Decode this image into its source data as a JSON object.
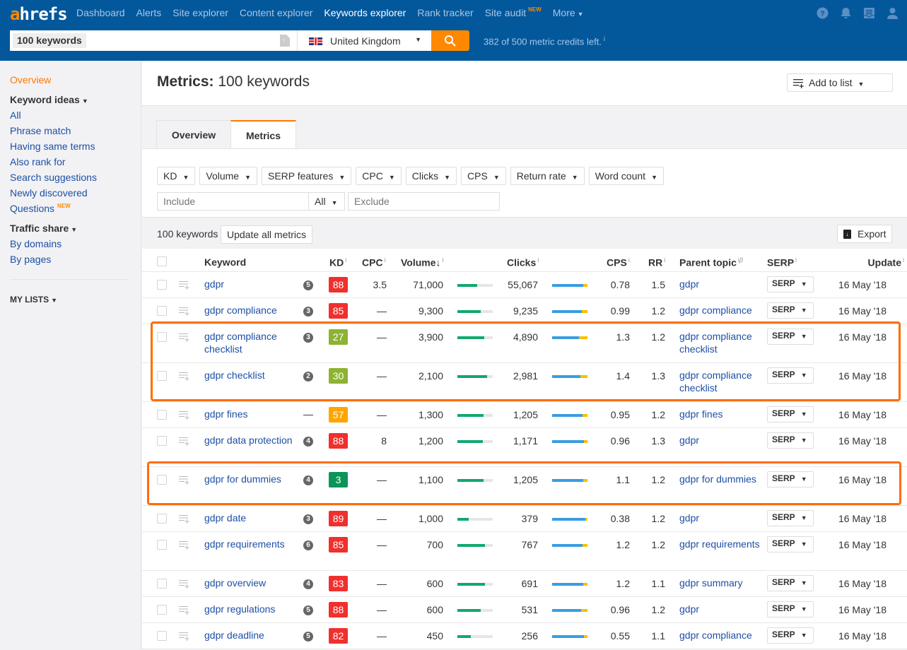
{
  "brand": {
    "logo_a": "a",
    "logo_rest": "hrefs",
    "accent": "#ff8800",
    "header_bg": "#03589c"
  },
  "nav": [
    {
      "label": "Dashboard",
      "active": false
    },
    {
      "label": "Alerts",
      "active": false
    },
    {
      "label": "Site explorer",
      "active": false
    },
    {
      "label": "Content explorer",
      "active": false
    },
    {
      "label": "Keywords explorer",
      "active": true
    },
    {
      "label": "Rank tracker",
      "active": false
    },
    {
      "label": "Site audit",
      "badge": "NEW",
      "active": false
    },
    {
      "label": "More",
      "active": false
    }
  ],
  "top_icons": [
    "help-icon",
    "bell-icon",
    "messages-icon",
    "user-icon"
  ],
  "search": {
    "keyword_chip": "100 keywords",
    "country": "United Kingdom",
    "credits": "382 of 500 metric credits left.",
    "credits_info": "i"
  },
  "sidebar": {
    "overview": "Overview",
    "keyword_ideas": "Keyword ideas",
    "idea_items": [
      "All",
      "Phrase match",
      "Having same terms",
      "Also rank for",
      "Search suggestions",
      "Newly discovered",
      "Questions"
    ],
    "questions_badge": "NEW",
    "traffic_share": "Traffic share",
    "traffic_items": [
      "By domains",
      "By pages"
    ],
    "my_lists": "MY LISTS"
  },
  "page": {
    "title_bold": "Metrics:",
    "title_rest": "100 keywords",
    "add_to_list": "Add to list"
  },
  "tabs": [
    {
      "label": "Overview",
      "active": false
    },
    {
      "label": "Metrics",
      "active": true
    }
  ],
  "filters": {
    "buttons": [
      "KD",
      "Volume",
      "SERP features",
      "CPC",
      "Clicks",
      "CPS",
      "Return rate",
      "Word count"
    ],
    "include_placeholder": "Include",
    "match_mode": "All",
    "exclude_placeholder": "Exclude"
  },
  "count_bar": {
    "count": "100 keywords",
    "update_all": "Update all metrics",
    "export": "Export"
  },
  "table": {
    "headers": {
      "keyword": "Keyword",
      "kd": "KD",
      "cpc": "CPC",
      "volume": "Volume",
      "clicks": "Clicks",
      "cps": "CPS",
      "rr": "RR",
      "parent_topic": "Parent topic",
      "serp": "SERP",
      "update": "Update",
      "info": "i",
      "beta": "β",
      "sort_arrow": "↓"
    },
    "serp_button": "SERP",
    "rows": [
      {
        "keyword": "gdpr",
        "serp_features": "5",
        "kd": "88",
        "kd_color": "#f0302d",
        "cpc": "3.5",
        "volume": "71,000",
        "volume_bar": 0.56,
        "clicks": "55,067",
        "clicks_organic_share": 0.88,
        "cps": "0.78",
        "rr": "1.5",
        "parent_topic": "gdpr",
        "update": "16 May '18"
      },
      {
        "keyword": "gdpr compliance",
        "serp_features": "3",
        "kd": "85",
        "kd_color": "#f0302d",
        "cpc": "—",
        "volume": "9,300",
        "volume_bar": 0.66,
        "clicks": "9,235",
        "clicks_organic_share": 0.84,
        "cps": "0.99",
        "rr": "1.2",
        "parent_topic": "gdpr compliance",
        "update": "16 May '18"
      },
      {
        "keyword": "gdpr compliance checklist",
        "serp_features": "3",
        "kd": "27",
        "kd_color": "#8cb332",
        "cpc": "—",
        "volume": "3,900",
        "volume_bar": 0.76,
        "clicks": "4,890",
        "clicks_organic_share": 0.76,
        "cps": "1.3",
        "rr": "1.2",
        "parent_topic": "gdpr compliance checklist",
        "update": "16 May '18",
        "highlight": "group1"
      },
      {
        "keyword": "gdpr checklist",
        "serp_features": "2",
        "kd": "30",
        "kd_color": "#8cb332",
        "cpc": "—",
        "volume": "2,100",
        "volume_bar": 0.84,
        "clicks": "2,981",
        "clicks_organic_share": 0.8,
        "cps": "1.4",
        "rr": "1.3",
        "parent_topic": "gdpr compliance checklist",
        "update": "16 May '18",
        "highlight": "group1"
      },
      {
        "keyword": "gdpr fines",
        "serp_features": "—",
        "kd": "57",
        "kd_color": "#ffa500",
        "cpc": "—",
        "volume": "1,300",
        "volume_bar": 0.74,
        "clicks": "1,205",
        "clicks_organic_share": 0.86,
        "cps": "0.95",
        "rr": "1.2",
        "parent_topic": "gdpr fines",
        "update": "16 May '18"
      },
      {
        "keyword": "gdpr data protection",
        "serp_features": "4",
        "kd": "88",
        "kd_color": "#f0302d",
        "cpc": "8",
        "volume": "1,200",
        "volume_bar": 0.72,
        "clicks": "1,171",
        "clicks_organic_share": 0.9,
        "cps": "0.96",
        "rr": "1.3",
        "parent_topic": "gdpr",
        "update": "16 May '18"
      },
      {
        "keyword": "gdpr for dummies",
        "serp_features": "4",
        "kd": "3",
        "kd_color": "#0b9457",
        "cpc": "—",
        "volume": "1,100",
        "volume_bar": 0.74,
        "clicks": "1,205",
        "clicks_organic_share": 0.88,
        "cps": "1.1",
        "rr": "1.2",
        "parent_topic": "gdpr for dummies",
        "update": "16 May '18",
        "highlight": "group2"
      },
      {
        "keyword": "gdpr date",
        "serp_features": "3",
        "kd": "89",
        "kd_color": "#f0302d",
        "cpc": "—",
        "volume": "1,000",
        "volume_bar": 0.32,
        "clicks": "379",
        "clicks_organic_share": 0.94,
        "cps": "0.38",
        "rr": "1.2",
        "parent_topic": "gdpr",
        "update": "16 May '18"
      },
      {
        "keyword": "gdpr requirements",
        "serp_features": "6",
        "kd": "85",
        "kd_color": "#f0302d",
        "cpc": "—",
        "volume": "700",
        "volume_bar": 0.78,
        "clicks": "767",
        "clicks_organic_share": 0.86,
        "cps": "1.2",
        "rr": "1.2",
        "parent_topic": "gdpr requirements",
        "update": "16 May '18"
      },
      {
        "keyword": "gdpr overview",
        "serp_features": "4",
        "kd": "83",
        "kd_color": "#f0302d",
        "cpc": "—",
        "volume": "600",
        "volume_bar": 0.78,
        "clicks": "691",
        "clicks_organic_share": 0.88,
        "cps": "1.2",
        "rr": "1.1",
        "parent_topic": "gdpr summary",
        "update": "16 May '18"
      },
      {
        "keyword": "gdpr regulations",
        "serp_features": "5",
        "kd": "88",
        "kd_color": "#f0302d",
        "cpc": "—",
        "volume": "600",
        "volume_bar": 0.66,
        "clicks": "531",
        "clicks_organic_share": 0.82,
        "cps": "0.96",
        "rr": "1.2",
        "parent_topic": "gdpr",
        "update": "16 May '18"
      },
      {
        "keyword": "gdpr deadline",
        "serp_features": "5",
        "kd": "82",
        "kd_color": "#f0302d",
        "cpc": "—",
        "volume": "450",
        "volume_bar": 0.38,
        "clicks": "256",
        "clicks_organic_share": 0.9,
        "cps": "0.55",
        "rr": "1.1",
        "parent_topic": "gdpr compliance",
        "update": "16 May '18"
      }
    ]
  }
}
